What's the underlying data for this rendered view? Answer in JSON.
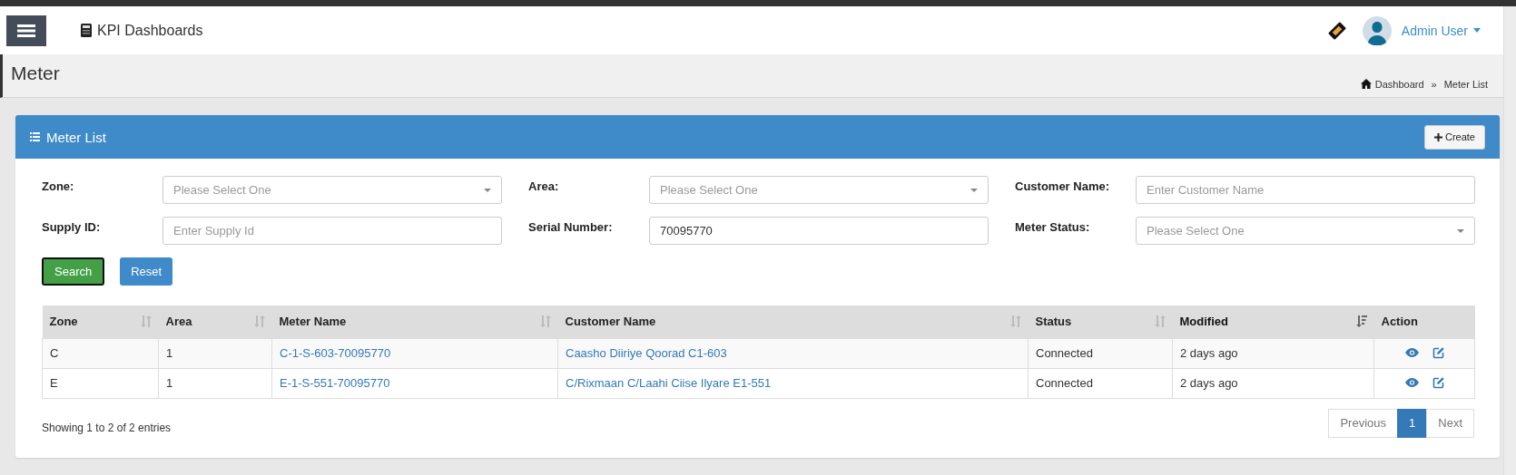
{
  "header": {
    "app_title": "KPI Dashboards",
    "user_name": "Admin User"
  },
  "page": {
    "title": "Meter",
    "breadcrumb_separator": "»",
    "breadcrumbs": [
      {
        "label": "Dashboard",
        "kind": "home"
      },
      {
        "label": "Meter List",
        "kind": "current"
      }
    ]
  },
  "panel": {
    "title": "Meter List",
    "create_button": "Create"
  },
  "filters": [
    {
      "label": "Zone:",
      "kind": "select",
      "placeholder": "Please Select One"
    },
    {
      "label": "Area:",
      "kind": "select",
      "placeholder": "Please Select One"
    },
    {
      "label": "Customer Name:",
      "kind": "text",
      "placeholder": "Enter Customer Name"
    },
    {
      "label": "Supply ID:",
      "kind": "text",
      "placeholder": "Enter Supply Id"
    },
    {
      "label": "Serial Number:",
      "kind": "text",
      "value": "70095770"
    },
    {
      "label": "Meter Status:",
      "kind": "select",
      "placeholder": "Please Select One"
    }
  ],
  "buttons": [
    {
      "label": "Search",
      "kind": "primary"
    },
    {
      "label": "Reset",
      "kind": "secondary"
    }
  ],
  "table": {
    "columns": [
      {
        "label": "Zone",
        "sortable": true,
        "sorted": false,
        "kind": "text"
      },
      {
        "label": "Area",
        "sortable": true,
        "sorted": false,
        "kind": "text"
      },
      {
        "label": "Meter Name",
        "sortable": true,
        "sorted": false,
        "kind": "link"
      },
      {
        "label": "Customer Name",
        "sortable": true,
        "sorted": false,
        "kind": "link"
      },
      {
        "label": "Status",
        "sortable": true,
        "sorted": false,
        "kind": "text"
      },
      {
        "label": "Modified",
        "sortable": true,
        "sorted": true,
        "kind": "text"
      },
      {
        "label": "Action",
        "sortable": false,
        "sorted": false,
        "kind": "actions"
      }
    ],
    "rows": [
      [
        "C",
        "1",
        "C-1-S-603-70095770",
        "Caasho Diiriye Qoorad C1-603",
        "Connected",
        "2 days ago"
      ],
      [
        "E",
        "1",
        "E-1-S-551-70095770",
        "C/Rixmaan C/Laahi Ciise Ilyare E1-551",
        "Connected",
        "2 days ago"
      ]
    ]
  },
  "footer": {
    "info": "Showing 1 to 2 of 2 entries",
    "pagination": [
      {
        "label": "Previous",
        "selected": false
      },
      {
        "label": "1",
        "selected": true
      },
      {
        "label": "Next",
        "selected": false
      }
    ]
  }
}
